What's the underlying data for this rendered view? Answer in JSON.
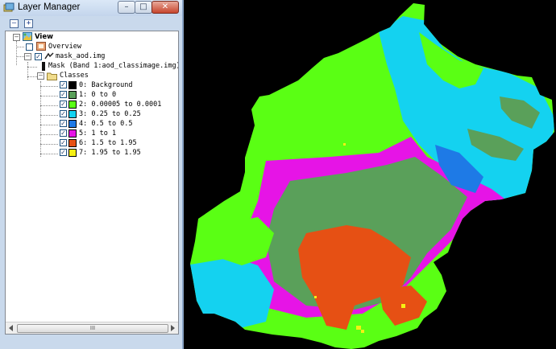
{
  "window": {
    "title": "Layer Manager",
    "min_glyph": "–",
    "max_glyph": "□",
    "close_glyph": "✕"
  },
  "toolbar": {
    "collapse_glyph": "–",
    "expand_glyph": "+"
  },
  "tree": {
    "view_label": "View",
    "overview_label": "Overview",
    "layer_label": "mask_aod.img",
    "mask_label": "Mask (Band 1:aod_classimage.img)",
    "classes_label": "Classes",
    "classes": [
      {
        "label": "0: Background",
        "color": "#000000"
      },
      {
        "label": "1: 0 to 0",
        "color": "#5aa05a"
      },
      {
        "label": "2: 0.00005 to 0.0001",
        "color": "#5aff14"
      },
      {
        "label": "3: 0.25 to 0.25",
        "color": "#14d2f0"
      },
      {
        "label": "4: 0.5 to 0.5",
        "color": "#1e7ae6"
      },
      {
        "label": "5: 1 to 1",
        "color": "#e614e6"
      },
      {
        "label": "6: 1.5 to 1.95",
        "color": "#e65014"
      },
      {
        "label": "7: 1.95 to 1.95",
        "color": "#f5f014"
      }
    ]
  },
  "scrollbar": {
    "thumb_grip": "III"
  },
  "colors": {
    "background": "#000000",
    "class_0_to_0": "#5aa05a",
    "class_2": "#5aff14",
    "class_3": "#14d2f0",
    "class_4": "#1e7ae6",
    "class_5": "#e614e6",
    "class_6": "#e65014",
    "class_7": "#f5f014"
  }
}
